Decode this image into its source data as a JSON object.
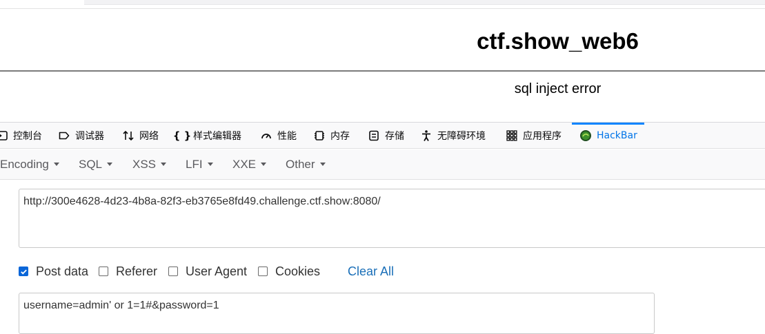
{
  "page": {
    "title": "ctf.show_web6",
    "message": "sql inject error"
  },
  "devtools": {
    "tabs": [
      {
        "label": "控制台",
        "icon": "console-icon"
      },
      {
        "label": "调试器",
        "icon": "debugger-icon"
      },
      {
        "label": "网络",
        "icon": "network-icon"
      },
      {
        "label": "样式编辑器",
        "icon": "style-editor-icon"
      },
      {
        "label": "性能",
        "icon": "performance-icon"
      },
      {
        "label": "内存",
        "icon": "memory-icon"
      },
      {
        "label": "存储",
        "icon": "storage-icon"
      },
      {
        "label": "无障碍环境",
        "icon": "accessibility-icon"
      },
      {
        "label": "应用程序",
        "icon": "application-icon"
      },
      {
        "label": "HackBar",
        "icon": "hackbar-icon",
        "active": true
      }
    ],
    "active_color": "#0074e8"
  },
  "hackbar": {
    "menu": [
      "Encoding",
      "SQL",
      "XSS",
      "LFI",
      "XXE",
      "Other"
    ],
    "url": "http://300e4628-4d23-4b8a-82f3-eb3765e8fd49.challenge.ctf.show:8080/",
    "options": [
      {
        "label": "Post data",
        "checked": true
      },
      {
        "label": "Referer",
        "checked": false
      },
      {
        "label": "User Agent",
        "checked": false
      },
      {
        "label": "Cookies",
        "checked": false
      }
    ],
    "clear_all": "Clear All",
    "post_data": "username=admin' or 1=1#&password=1",
    "accent": "#0a66d8"
  }
}
